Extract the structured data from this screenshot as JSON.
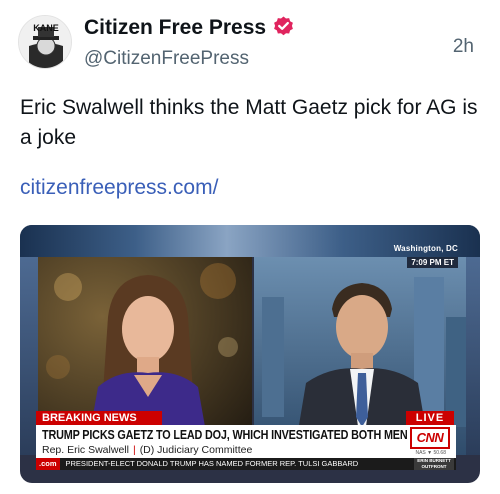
{
  "author": {
    "display_name": "Citizen Free Press",
    "handle": "@CitizenFreePress",
    "avatar_text": "KANE",
    "verified_icon": "verified-badge-icon",
    "verified_color": "#e0245e"
  },
  "timestamp": "2h",
  "post": {
    "text": "Eric Swalwell thinks the Matt Gaetz pick for AG is a joke",
    "link": "citizenfreepress.com/"
  },
  "media": {
    "location": "Washington, DC",
    "time": "7:09 PM ET",
    "breaking_label": "BREAKING NEWS",
    "live_label": "LIVE",
    "headline": "TRUMP PICKS GAETZ TO LEAD DOJ, WHICH INVESTIGATED BOTH MEN",
    "subhead_name": "Rep. Eric Swalwell",
    "subhead_sep": "|",
    "subhead_role": "(D) Judiciary Committee",
    "network_logo": "CNN",
    "market_text": "NAS ▼ 50.68",
    "ticker_site": ".com",
    "ticker_text": "PRESIDENT-ELECT DONALD TRUMP HAS NAMED FORMER REP. TULSI GABBARD",
    "show_name": "ERIN BURNETT OUTFRONT"
  },
  "colors": {
    "link": "#3a5fb8",
    "cnn_red": "#cc0000",
    "secondary_text": "#536471"
  }
}
